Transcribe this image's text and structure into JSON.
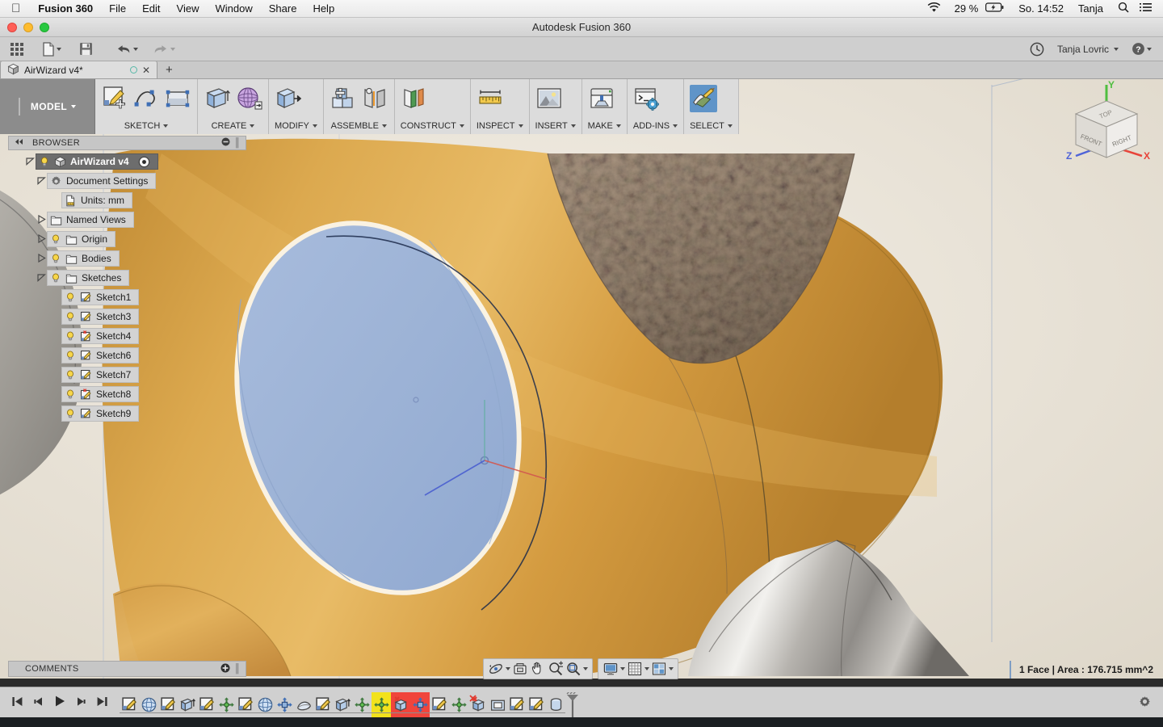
{
  "mac_menubar": {
    "apple_icon": "apple-icon",
    "items": [
      {
        "label": "Fusion 360",
        "bold": true
      },
      {
        "label": "File",
        "bold": false
      },
      {
        "label": "Edit",
        "bold": false
      },
      {
        "label": "View",
        "bold": false
      },
      {
        "label": "Window",
        "bold": false
      },
      {
        "label": "Share",
        "bold": false
      },
      {
        "label": "Help",
        "bold": false
      }
    ],
    "status": {
      "wifi_icon": "wifi-icon",
      "battery_percent": "29 %",
      "battery_icon": "battery-charging-icon",
      "datetime": "So. 14:52",
      "user": "Tanja",
      "search_icon": "search-icon",
      "notification_icon": "notification-center-icon"
    }
  },
  "window": {
    "title": "Autodesk Fusion 360",
    "close": "close-button",
    "minimize": "minimize-button",
    "zoom": "zoom-button"
  },
  "app_toolbar": {
    "grid_button": "app-grid-icon",
    "new_button": "new-document-icon",
    "save_button": "save-icon",
    "undo_button": "undo-icon",
    "redo_button": "redo-icon",
    "history_button": "clock-icon",
    "account_name": "Tanja Lovric",
    "help_button": "help-icon"
  },
  "tabs": {
    "documents": [
      {
        "label": "AirWizard v4*",
        "icon": "cube-icon",
        "modified_dot": "unsaved-circle",
        "close": "close-icon"
      }
    ],
    "new_tab": "+"
  },
  "ribbon": {
    "workspace": {
      "label": "MODEL",
      "caret": true
    },
    "groups": [
      {
        "label": "SKETCH",
        "icons": [
          "create-sketch-icon",
          "spline-icon",
          "rectangle-icon"
        ]
      },
      {
        "label": "CREATE",
        "icons": [
          "extrude-icon",
          "revolve-icon"
        ]
      },
      {
        "label": "MODIFY",
        "icons": [
          "press-pull-icon"
        ]
      },
      {
        "label": "ASSEMBLE",
        "icons": [
          "new-component-icon",
          "joint-icon"
        ]
      },
      {
        "label": "CONSTRUCT",
        "icons": [
          "offset-plane-icon"
        ]
      },
      {
        "label": "INSPECT",
        "icons": [
          "measure-icon"
        ]
      },
      {
        "label": "INSERT",
        "icons": [
          "insert-image-icon"
        ]
      },
      {
        "label": "MAKE",
        "icons": [
          "3d-print-icon"
        ]
      },
      {
        "label": "ADD-INS",
        "icons": [
          "scripts-addins-icon"
        ]
      },
      {
        "label": "SELECT",
        "icons": [
          "select-icon"
        ],
        "active": true
      }
    ]
  },
  "browser": {
    "header": {
      "collapse_icon": "collapse-left-icon",
      "title": "BROWSER",
      "minus_icon": "minimize-panel-icon",
      "grip": "resize-grip"
    },
    "tree": [
      {
        "label": "AirWizard v4",
        "depth": 0,
        "disclosure": "expanded",
        "light": true,
        "icon": "component-cube-icon",
        "active": true,
        "trailing": "activate-target-icon"
      },
      {
        "label": "Document Settings",
        "depth": 1,
        "disclosure": "expanded",
        "light": false,
        "icon": "gear-icon",
        "active": false
      },
      {
        "label": "Units: mm",
        "depth": 2,
        "disclosure": "none",
        "light": false,
        "icon": "units-doc-icon",
        "active": false
      },
      {
        "label": "Named Views",
        "depth": 1,
        "disclosure": "collapsed",
        "light": false,
        "icon": "folder-icon",
        "active": false
      },
      {
        "label": "Origin",
        "depth": 1,
        "disclosure": "collapsed",
        "light": true,
        "icon": "folder-icon",
        "active": false
      },
      {
        "label": "Bodies",
        "depth": 1,
        "disclosure": "collapsed",
        "light": true,
        "icon": "folder-icon",
        "active": false
      },
      {
        "label": "Sketches",
        "depth": 1,
        "disclosure": "expanded",
        "light": true,
        "icon": "folder-icon",
        "active": false
      },
      {
        "label": "Sketch1",
        "depth": 2,
        "disclosure": "none",
        "light": true,
        "icon": "sketch-icon",
        "active": false
      },
      {
        "label": "Sketch3",
        "depth": 2,
        "disclosure": "none",
        "light": true,
        "icon": "sketch-icon",
        "active": false
      },
      {
        "label": "Sketch4",
        "depth": 2,
        "disclosure": "none",
        "light": true,
        "icon": "sketch-warning-icon",
        "active": false
      },
      {
        "label": "Sketch6",
        "depth": 2,
        "disclosure": "none",
        "light": true,
        "icon": "sketch-icon",
        "active": false
      },
      {
        "label": "Sketch7",
        "depth": 2,
        "disclosure": "none",
        "light": true,
        "icon": "sketch-icon",
        "active": false
      },
      {
        "label": "Sketch8",
        "depth": 2,
        "disclosure": "none",
        "light": true,
        "icon": "sketch-warning-icon",
        "active": false
      },
      {
        "label": "Sketch9",
        "depth": 2,
        "disclosure": "none",
        "light": true,
        "icon": "sketch-icon",
        "active": false
      }
    ]
  },
  "viewcube": {
    "faces": {
      "top": "TOP",
      "front": "FRONT",
      "right": "RIGHT"
    },
    "axes": {
      "x": "X",
      "y": "Y",
      "z": "Z"
    },
    "axis_colors": {
      "x": "#e8443a",
      "y": "#4fbe3f",
      "z": "#4f63d8"
    }
  },
  "comments_panel": {
    "title": "COMMENTS",
    "add_icon": "add-comment-icon",
    "grip": "resize-grip"
  },
  "nav_toolbar": {
    "groups": [
      {
        "items": [
          "orbit-icon",
          "look-at-icon",
          "pan-icon",
          "zoom-icon",
          "fit-icon"
        ]
      },
      {
        "items": [
          "display-settings-icon",
          "grid-snap-icon",
          "viewport-layout-icon"
        ]
      }
    ]
  },
  "status_bar": {
    "selection": "1 Face | Area : 176.715 mm^2"
  },
  "timeline": {
    "playback": [
      "skip-to-start-icon",
      "step-back-icon",
      "play-icon",
      "step-forward-icon",
      "skip-to-end-icon"
    ],
    "features": [
      {
        "icon": "sketch-icon",
        "state": "normal"
      },
      {
        "icon": "revolve-icon",
        "state": "normal"
      },
      {
        "icon": "sketch-icon",
        "state": "normal"
      },
      {
        "icon": "extrude-icon",
        "state": "normal"
      },
      {
        "icon": "sketch-icon",
        "state": "normal"
      },
      {
        "icon": "move-icon",
        "state": "normal"
      },
      {
        "icon": "sketch-icon",
        "state": "normal"
      },
      {
        "icon": "revolve-icon",
        "state": "normal"
      },
      {
        "icon": "pattern-icon",
        "state": "normal"
      },
      {
        "icon": "loft-icon",
        "state": "normal"
      },
      {
        "icon": "sketch-icon",
        "state": "normal"
      },
      {
        "icon": "extrude-icon",
        "state": "normal"
      },
      {
        "icon": "move-icon",
        "state": "normal"
      },
      {
        "icon": "move-icon",
        "state": "warning"
      },
      {
        "icon": "remove-body-icon",
        "state": "error"
      },
      {
        "icon": "pattern-icon",
        "state": "error"
      },
      {
        "icon": "sketch-icon",
        "state": "normal"
      },
      {
        "icon": "move-icon",
        "state": "normal"
      },
      {
        "icon": "remove-body-icon",
        "state": "error-marker"
      },
      {
        "icon": "shell-icon",
        "state": "normal"
      },
      {
        "icon": "sketch-icon",
        "state": "normal"
      },
      {
        "icon": "sketch-icon",
        "state": "normal"
      },
      {
        "icon": "cylinder-icon",
        "state": "normal"
      }
    ],
    "playhead": "timeline-playhead",
    "settings_icon": "gear-icon"
  },
  "colors": {
    "selected_face": "#9db3d6",
    "model_gold": "#d39b3f",
    "metal_gray": "#a9a6a1",
    "cork_brown": "#9c8773",
    "background": "#e9e3d8",
    "timeline_warning": "#f2e21c",
    "timeline_error": "#f0453c",
    "accent_blue": "#5f94c8"
  }
}
